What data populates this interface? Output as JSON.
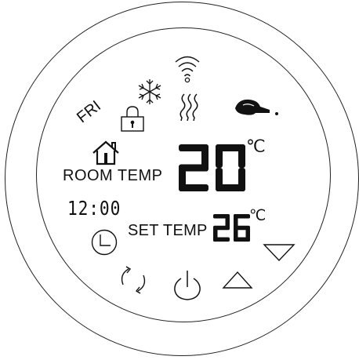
{
  "display": {
    "day": "FRI",
    "room_label": "ROOM TEMP",
    "room_temp": "20",
    "room_unit": "℃",
    "clock": "12:00",
    "set_label": "SET TEMP",
    "set_temp": "26",
    "set_unit": "℃"
  },
  "icons": {
    "wifi": "wifi-icon",
    "cooling": "snowflake-icon",
    "heating": "heat-waves-icon",
    "lock": "lock-icon",
    "home": "home-icon",
    "eco": "eco-icon"
  },
  "buttons": {
    "clock": "clock-button",
    "mode": "cycle-button",
    "power": "power-button",
    "up": "up-button",
    "down": "down-button"
  }
}
